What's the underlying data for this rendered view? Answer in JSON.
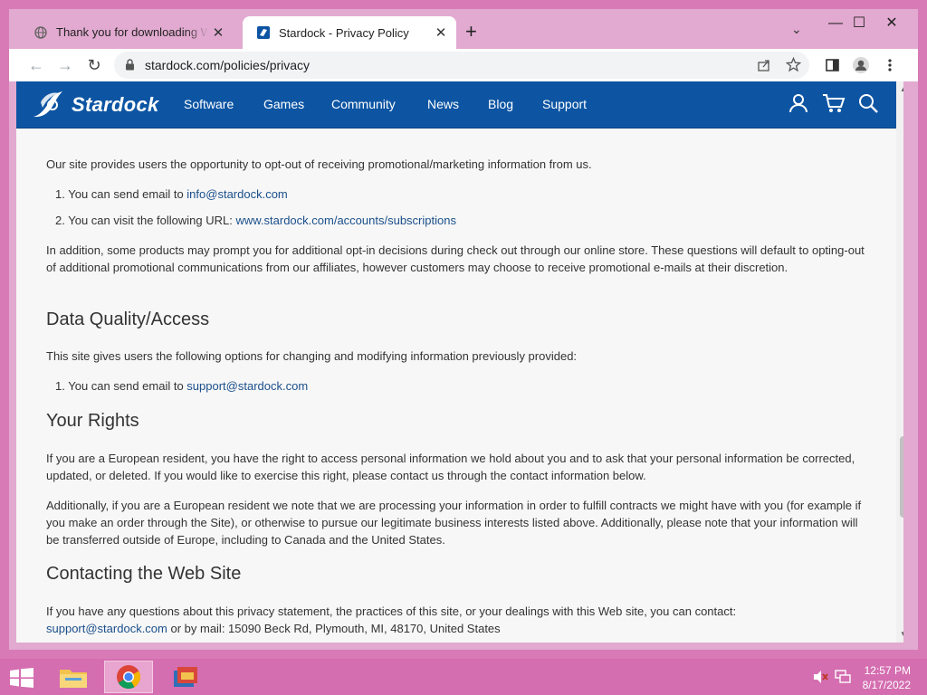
{
  "tabs": [
    {
      "title": "Thank you for downloading Wind",
      "close": "✕"
    },
    {
      "title": "Stardock - Privacy Policy",
      "close": "✕"
    }
  ],
  "new_tab": "+",
  "tab_dropdown": "⌄",
  "window_controls": {
    "minimize": "—",
    "maximize": "☐",
    "close": "✕"
  },
  "toolbar": {
    "back": "←",
    "forward": "→",
    "reload": "↻",
    "url": "stardock.com/policies/privacy"
  },
  "site_nav": {
    "logo": "Stardock",
    "items": [
      "Software",
      "Games",
      "Community",
      "News",
      "Blog",
      "Support"
    ]
  },
  "content": {
    "optout_intro": "Our site provides users the opportunity to opt-out of receiving promotional/marketing information from us.",
    "optout_items": [
      {
        "num": "1.",
        "text": "You can send email to ",
        "link": "info@stardock.com"
      },
      {
        "num": "2.",
        "text": "You can visit the following URL: ",
        "link": "www.stardock.com/accounts/subscriptions"
      }
    ],
    "optout_addition": "In addition, some products may prompt you for additional opt-in decisions during check out through our online store.  These questions will default to opting-out of additional promotional communications from our affiliates, however customers may choose to receive promotional e-mails at their discretion.",
    "dq_heading": "Data Quality/Access",
    "dq_intro": "This site gives users the following options for changing and modifying information previously provided:",
    "dq_items": [
      {
        "num": "1.",
        "text": "You can send email to ",
        "link": "support@stardock.com"
      }
    ],
    "rights_heading": "Your Rights",
    "rights_p1": "If you are a European resident, you have the right to access personal information we hold about you and to ask that your personal information be corrected, updated, or deleted. If you would like to exercise this right, please contact us through the contact information below.",
    "rights_p2": "Additionally, if you are a European resident we note that we are processing your information in order to fulfill contracts we might have with you (for example if you make an order through the Site), or otherwise to pursue our legitimate business interests listed above. Additionally, please note that your information will be transferred outside of Europe, including to Canada and the United States.",
    "contact_heading": "Contacting the Web Site",
    "contact_p_text": "If you have any questions about this privacy statement, the practices of this site, or your dealings with this Web site, you can contact:",
    "contact_link": "support@stardock.com",
    "contact_mail": " or by mail: 15090 Beck Rd, Plymouth, MI, 48170, United States"
  },
  "taskbar": {
    "time": "12:57 PM",
    "date": "8/17/2022"
  },
  "colors": {
    "navbar": "#0d55a3",
    "link": "#1a4f8b",
    "desktop": "#d87ab6"
  }
}
